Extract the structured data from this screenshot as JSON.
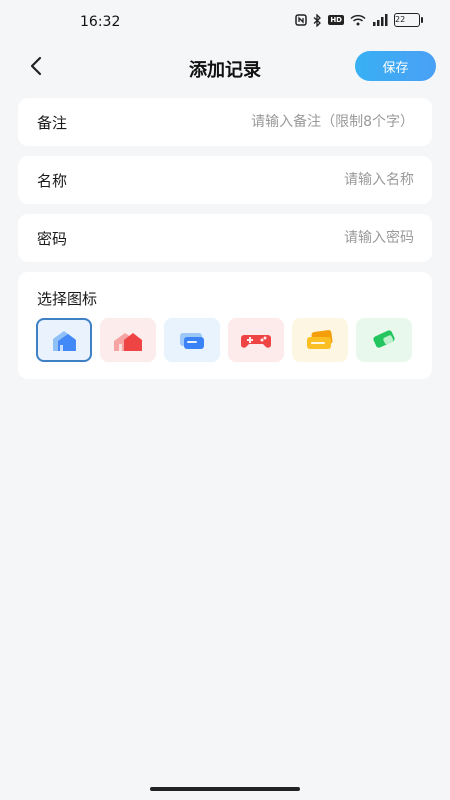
{
  "status_bar": {
    "time": "16:32",
    "battery": "22",
    "icons": [
      "nfc-icon",
      "bluetooth-icon",
      "hd-icon",
      "wifi-icon",
      "signal-icon",
      "battery-icon"
    ]
  },
  "header": {
    "title": "添加记录",
    "save_label": "保存",
    "back_icon": "chevron-left-icon"
  },
  "form": {
    "note": {
      "label": "备注",
      "placeholder": "请输入备注（限制8个字）",
      "value": ""
    },
    "name": {
      "label": "名称",
      "placeholder": "请输入名称",
      "value": ""
    },
    "password": {
      "label": "密码",
      "placeholder": "请输入密码",
      "value": ""
    }
  },
  "icon_picker": {
    "title": "选择图标",
    "selected_index": 0,
    "options": [
      {
        "name": "house-blue-icon",
        "color": "#3b82f6",
        "bg": "#e9f2fd"
      },
      {
        "name": "house-red-icon",
        "color": "#ef4444",
        "bg": "#fdecec"
      },
      {
        "name": "card-blue-icon",
        "color": "#3b82f6",
        "bg": "#e8f3fd"
      },
      {
        "name": "gamepad-red-icon",
        "color": "#ef4444",
        "bg": "#fdeaea"
      },
      {
        "name": "wallet-orange-icon",
        "color": "#f59e0b",
        "bg": "#fdf6e3"
      },
      {
        "name": "eraser-green-icon",
        "color": "#22c55e",
        "bg": "#e9f8ec"
      }
    ]
  },
  "colors": {
    "accent": "#3fa8f5",
    "background": "#f5f6f8",
    "card": "#ffffff",
    "placeholder": "#9a9a9a"
  }
}
